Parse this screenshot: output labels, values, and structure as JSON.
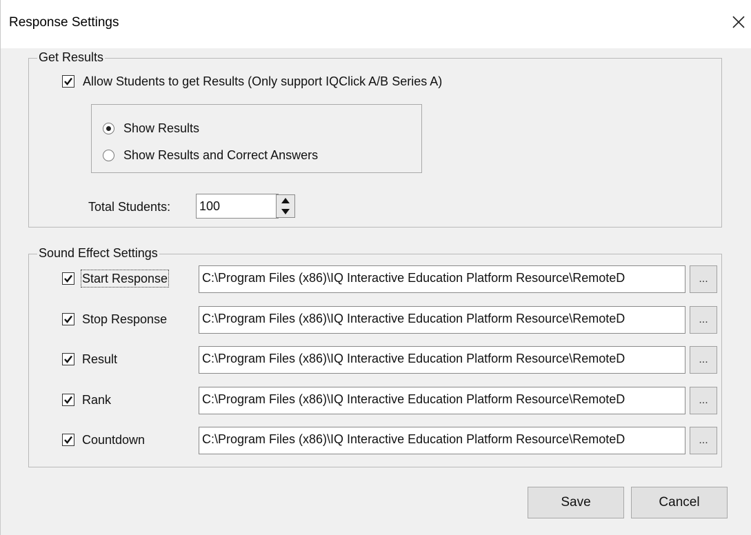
{
  "window": {
    "title": "Response Settings",
    "close_icon": "close-icon"
  },
  "get_results": {
    "legend": "Get Results",
    "allow_label": "Allow Students to get Results (Only support IQClick A/B Series A)",
    "allow_checked": true,
    "options": [
      {
        "label": "Show Results",
        "selected": true
      },
      {
        "label": "Show Results and Correct Answers",
        "selected": false
      }
    ],
    "total_students_label": "Total Students:",
    "total_students_value": "100"
  },
  "sound": {
    "legend": "Sound Effect Settings",
    "browse_label": "...",
    "items": [
      {
        "label": "Start Response",
        "checked": true,
        "path": "C:\\Program Files (x86)\\IQ Interactive Education Platform Resource\\RemoteD"
      },
      {
        "label": "Stop Response",
        "checked": true,
        "path": "C:\\Program Files (x86)\\IQ Interactive Education Platform Resource\\RemoteD"
      },
      {
        "label": "Result",
        "checked": true,
        "path": "C:\\Program Files (x86)\\IQ Interactive Education Platform Resource\\RemoteD"
      },
      {
        "label": "Rank",
        "checked": true,
        "path": "C:\\Program Files (x86)\\IQ Interactive Education Platform Resource\\RemoteD"
      },
      {
        "label": "Countdown",
        "checked": true,
        "path": "C:\\Program Files (x86)\\IQ Interactive Education Platform Resource\\RemoteD"
      }
    ]
  },
  "buttons": {
    "save": "Save",
    "cancel": "Cancel"
  }
}
